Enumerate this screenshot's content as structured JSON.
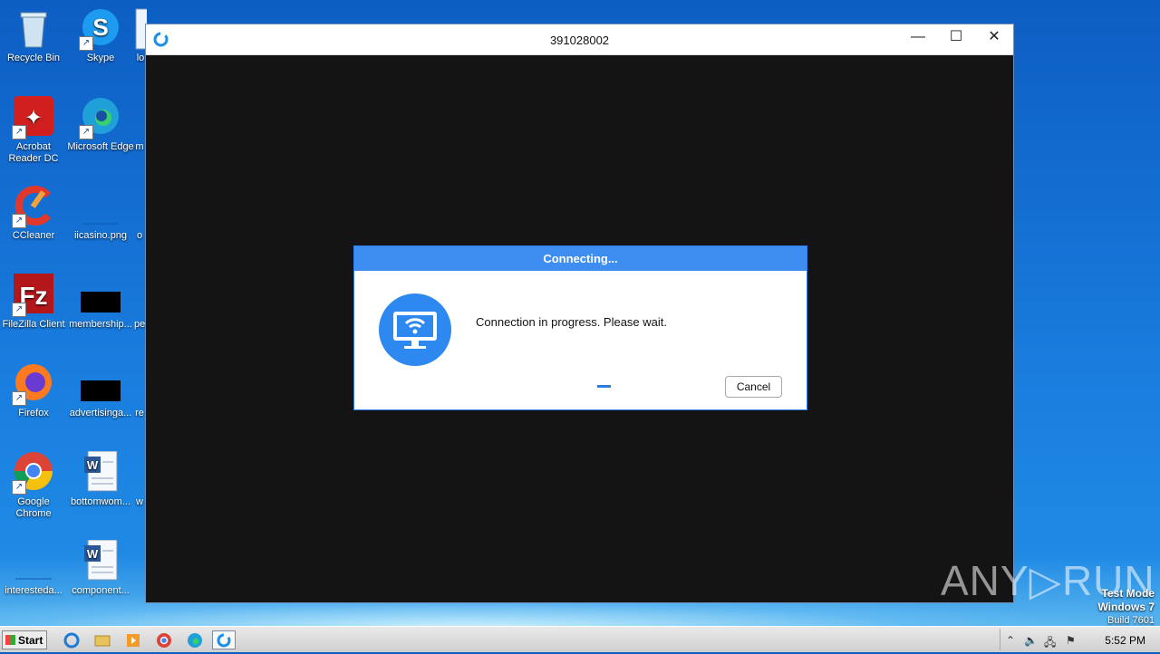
{
  "desktop": {
    "icons": [
      {
        "label": "Recycle Bin"
      },
      {
        "label": "Skype"
      },
      {
        "label": "Acrobat Reader DC"
      },
      {
        "label": "Microsoft Edge"
      },
      {
        "label": "CCleaner"
      },
      {
        "label": "iicasino.png"
      },
      {
        "label": "FileZilla Client"
      },
      {
        "label": "membership..."
      },
      {
        "label": "Firefox"
      },
      {
        "label": "advertisinga..."
      },
      {
        "label": "Google Chrome"
      },
      {
        "label": "bottomwom..."
      },
      {
        "label": "interesteda..."
      },
      {
        "label": "component..."
      }
    ],
    "partial_labels": [
      "lo",
      "m",
      "o",
      "pe",
      "re",
      "w"
    ]
  },
  "window": {
    "title": "391028002",
    "minimize": "—",
    "maximize": "☐",
    "close": "✕"
  },
  "dialog": {
    "title": "Connecting...",
    "message": "Connection in progress. Please wait.",
    "cancel_label": "Cancel"
  },
  "watermark": {
    "text": "ANY▷RUN"
  },
  "os": {
    "line1": "Test Mode",
    "line2": "Windows 7",
    "line3": "Build 7601"
  },
  "taskbar": {
    "start_label": "Start",
    "clock": "5:52 PM"
  },
  "colors": {
    "dialog_header": "#3d8ef0",
    "accent": "#2d89ef"
  }
}
